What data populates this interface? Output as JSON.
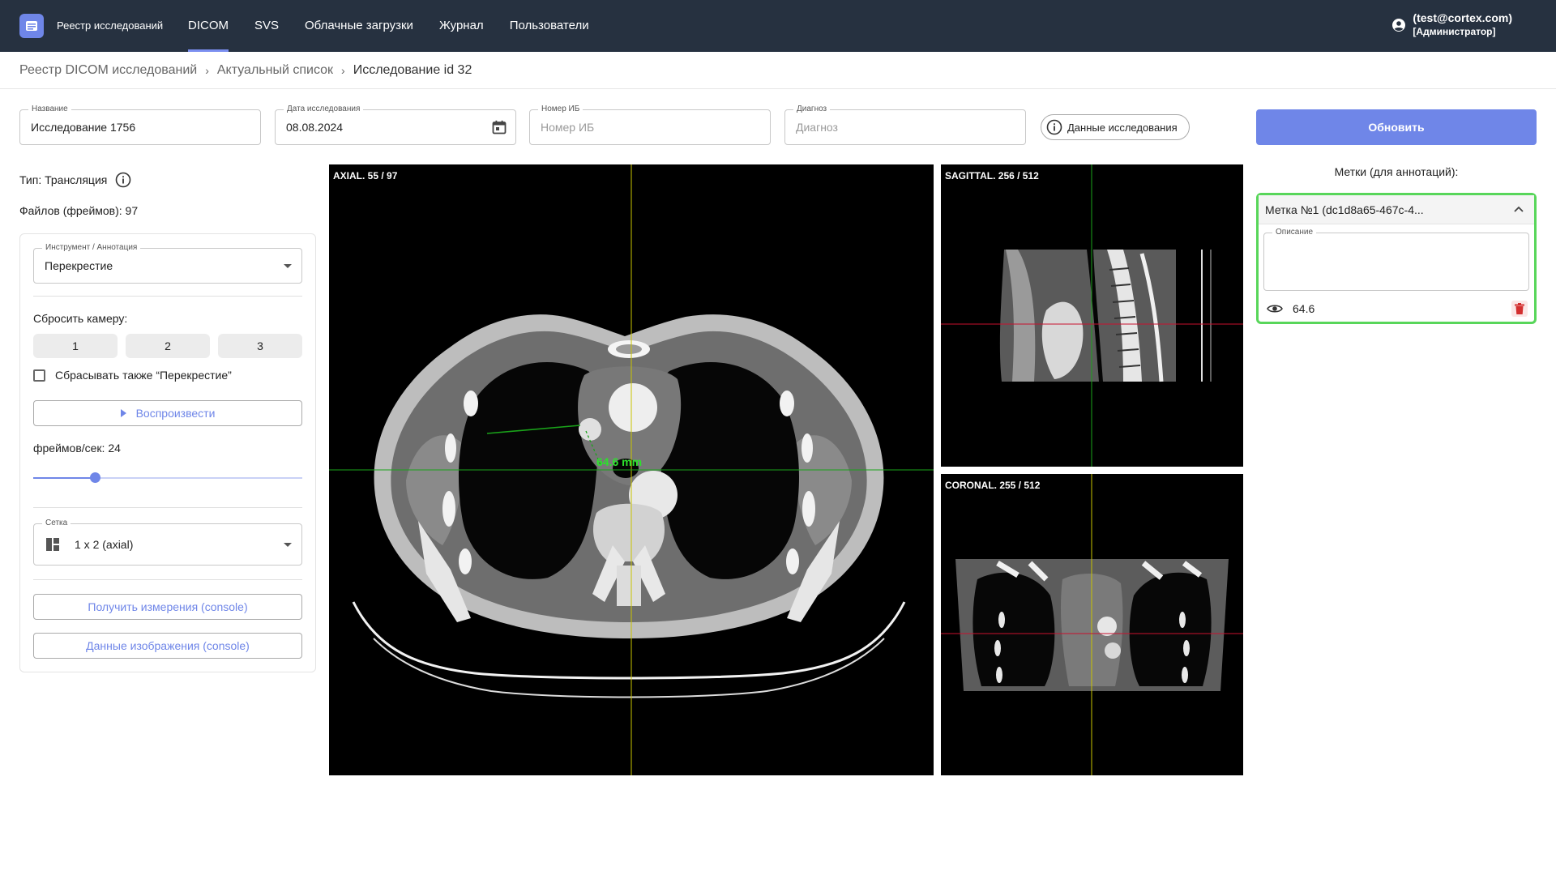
{
  "app": {
    "title": "Реестр исследований"
  },
  "nav": {
    "items": [
      "DICOM",
      "SVS",
      "Облачные загрузки",
      "Журнал",
      "Пользователи"
    ],
    "active": "DICOM"
  },
  "user": {
    "email": "(test@cortex.com)",
    "role": "[Администратор]"
  },
  "breadcrumbs": [
    "Реестр DICOM исследований",
    "Актуальный список",
    "Исследование id 32"
  ],
  "filters": {
    "name": {
      "label": "Название",
      "value": "Исследование 1756"
    },
    "date": {
      "label": "Дата исследования",
      "value": "08.08.2024"
    },
    "case_number": {
      "label": "Номер ИБ",
      "placeholder": "Номер ИБ"
    },
    "diagnosis": {
      "label": "Диагноз",
      "placeholder": "Диагноз"
    },
    "info_button": "Данные исследования",
    "update_button": "Обновить"
  },
  "study": {
    "type": "Тип: Трансляция",
    "files": "Файлов (фреймов): 97"
  },
  "tools": {
    "tool_label": "Инструмент / Аннотация",
    "tool_value": "Перекрестие",
    "reset_label": "Сбросить камеру:",
    "camera_buttons": [
      "1",
      "2",
      "3"
    ],
    "reset_crosshair": "Сбрасывать также “Перекрестие”",
    "play": "Воспроизвести",
    "fps_label": "фреймов/сек: 24",
    "fps_value": 24,
    "fps_fraction": 0.23,
    "grid_label": "Сетка",
    "grid_value": "1 x 2 (axial)",
    "get_measurements": "Получить измерения (console)",
    "image_data": "Данные изображения (console)"
  },
  "viewports": {
    "axial": {
      "label": "AXIAL. 55 / 97",
      "measurement": "64.6 mm"
    },
    "sagittal": {
      "label": "SAGITTAL. 256 / 512"
    },
    "coronal": {
      "label": "CORONAL. 255 / 512"
    }
  },
  "marks": {
    "title": "Метки (для аннотаций):",
    "items": [
      {
        "label": "Метка №1 (dc1d8a65-467c-4...",
        "description_label": "Описание",
        "value": "64.6"
      }
    ]
  },
  "colors": {
    "accent": "#6f86e8",
    "header": "#263140",
    "mark_border": "#58d65a",
    "crosshair_v": "#c9c400",
    "crosshair_h": "#1aa31a",
    "crosshair_red": "#c8102e",
    "delete": "#d32f2f"
  }
}
